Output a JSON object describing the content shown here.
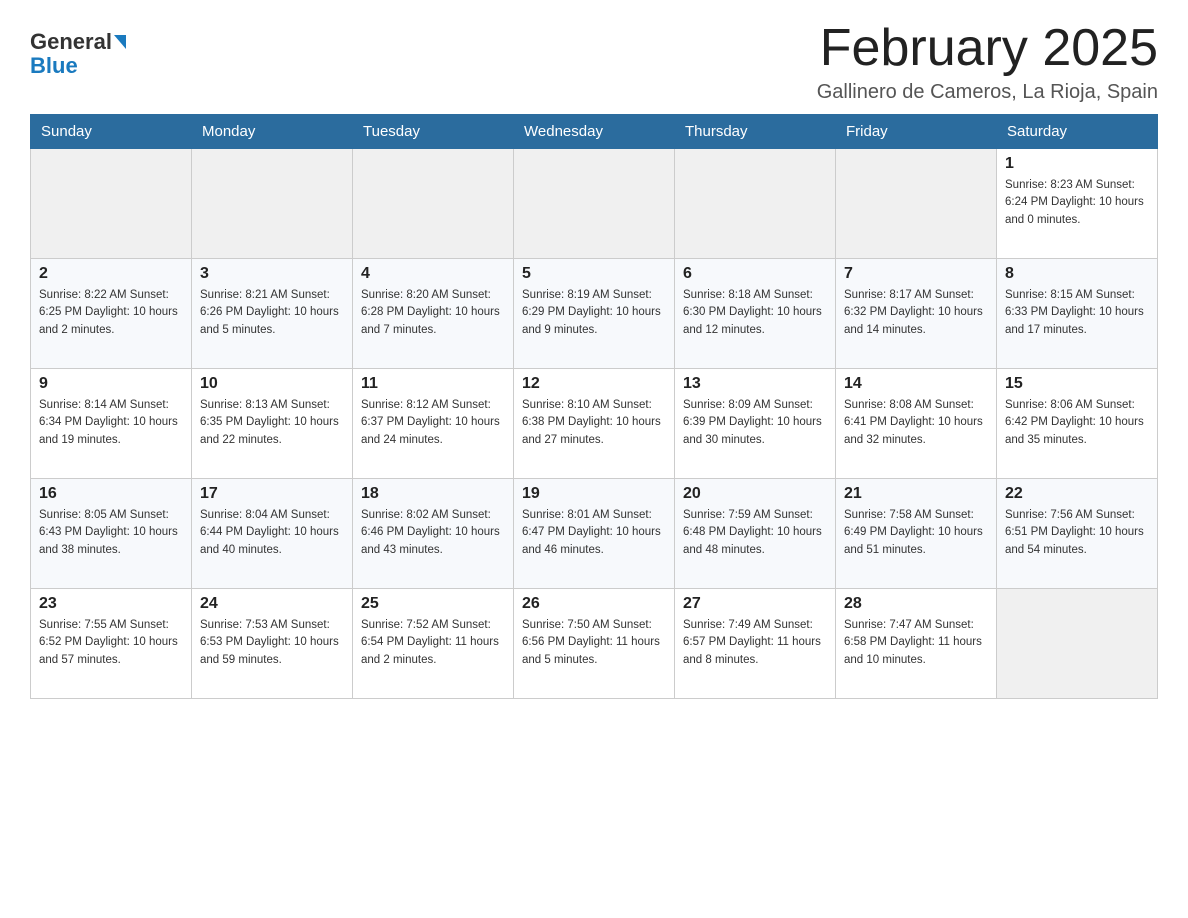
{
  "header": {
    "logo_line1": "General",
    "logo_line2": "Blue",
    "title": "February 2025",
    "subtitle": "Gallinero de Cameros, La Rioja, Spain"
  },
  "weekdays": [
    "Sunday",
    "Monday",
    "Tuesday",
    "Wednesday",
    "Thursday",
    "Friday",
    "Saturday"
  ],
  "weeks": [
    [
      {
        "day": "",
        "info": ""
      },
      {
        "day": "",
        "info": ""
      },
      {
        "day": "",
        "info": ""
      },
      {
        "day": "",
        "info": ""
      },
      {
        "day": "",
        "info": ""
      },
      {
        "day": "",
        "info": ""
      },
      {
        "day": "1",
        "info": "Sunrise: 8:23 AM\nSunset: 6:24 PM\nDaylight: 10 hours and 0 minutes."
      }
    ],
    [
      {
        "day": "2",
        "info": "Sunrise: 8:22 AM\nSunset: 6:25 PM\nDaylight: 10 hours and 2 minutes."
      },
      {
        "day": "3",
        "info": "Sunrise: 8:21 AM\nSunset: 6:26 PM\nDaylight: 10 hours and 5 minutes."
      },
      {
        "day": "4",
        "info": "Sunrise: 8:20 AM\nSunset: 6:28 PM\nDaylight: 10 hours and 7 minutes."
      },
      {
        "day": "5",
        "info": "Sunrise: 8:19 AM\nSunset: 6:29 PM\nDaylight: 10 hours and 9 minutes."
      },
      {
        "day": "6",
        "info": "Sunrise: 8:18 AM\nSunset: 6:30 PM\nDaylight: 10 hours and 12 minutes."
      },
      {
        "day": "7",
        "info": "Sunrise: 8:17 AM\nSunset: 6:32 PM\nDaylight: 10 hours and 14 minutes."
      },
      {
        "day": "8",
        "info": "Sunrise: 8:15 AM\nSunset: 6:33 PM\nDaylight: 10 hours and 17 minutes."
      }
    ],
    [
      {
        "day": "9",
        "info": "Sunrise: 8:14 AM\nSunset: 6:34 PM\nDaylight: 10 hours and 19 minutes."
      },
      {
        "day": "10",
        "info": "Sunrise: 8:13 AM\nSunset: 6:35 PM\nDaylight: 10 hours and 22 minutes."
      },
      {
        "day": "11",
        "info": "Sunrise: 8:12 AM\nSunset: 6:37 PM\nDaylight: 10 hours and 24 minutes."
      },
      {
        "day": "12",
        "info": "Sunrise: 8:10 AM\nSunset: 6:38 PM\nDaylight: 10 hours and 27 minutes."
      },
      {
        "day": "13",
        "info": "Sunrise: 8:09 AM\nSunset: 6:39 PM\nDaylight: 10 hours and 30 minutes."
      },
      {
        "day": "14",
        "info": "Sunrise: 8:08 AM\nSunset: 6:41 PM\nDaylight: 10 hours and 32 minutes."
      },
      {
        "day": "15",
        "info": "Sunrise: 8:06 AM\nSunset: 6:42 PM\nDaylight: 10 hours and 35 minutes."
      }
    ],
    [
      {
        "day": "16",
        "info": "Sunrise: 8:05 AM\nSunset: 6:43 PM\nDaylight: 10 hours and 38 minutes."
      },
      {
        "day": "17",
        "info": "Sunrise: 8:04 AM\nSunset: 6:44 PM\nDaylight: 10 hours and 40 minutes."
      },
      {
        "day": "18",
        "info": "Sunrise: 8:02 AM\nSunset: 6:46 PM\nDaylight: 10 hours and 43 minutes."
      },
      {
        "day": "19",
        "info": "Sunrise: 8:01 AM\nSunset: 6:47 PM\nDaylight: 10 hours and 46 minutes."
      },
      {
        "day": "20",
        "info": "Sunrise: 7:59 AM\nSunset: 6:48 PM\nDaylight: 10 hours and 48 minutes."
      },
      {
        "day": "21",
        "info": "Sunrise: 7:58 AM\nSunset: 6:49 PM\nDaylight: 10 hours and 51 minutes."
      },
      {
        "day": "22",
        "info": "Sunrise: 7:56 AM\nSunset: 6:51 PM\nDaylight: 10 hours and 54 minutes."
      }
    ],
    [
      {
        "day": "23",
        "info": "Sunrise: 7:55 AM\nSunset: 6:52 PM\nDaylight: 10 hours and 57 minutes."
      },
      {
        "day": "24",
        "info": "Sunrise: 7:53 AM\nSunset: 6:53 PM\nDaylight: 10 hours and 59 minutes."
      },
      {
        "day": "25",
        "info": "Sunrise: 7:52 AM\nSunset: 6:54 PM\nDaylight: 11 hours and 2 minutes."
      },
      {
        "day": "26",
        "info": "Sunrise: 7:50 AM\nSunset: 6:56 PM\nDaylight: 11 hours and 5 minutes."
      },
      {
        "day": "27",
        "info": "Sunrise: 7:49 AM\nSunset: 6:57 PM\nDaylight: 11 hours and 8 minutes."
      },
      {
        "day": "28",
        "info": "Sunrise: 7:47 AM\nSunset: 6:58 PM\nDaylight: 11 hours and 10 minutes."
      },
      {
        "day": "",
        "info": ""
      }
    ]
  ]
}
